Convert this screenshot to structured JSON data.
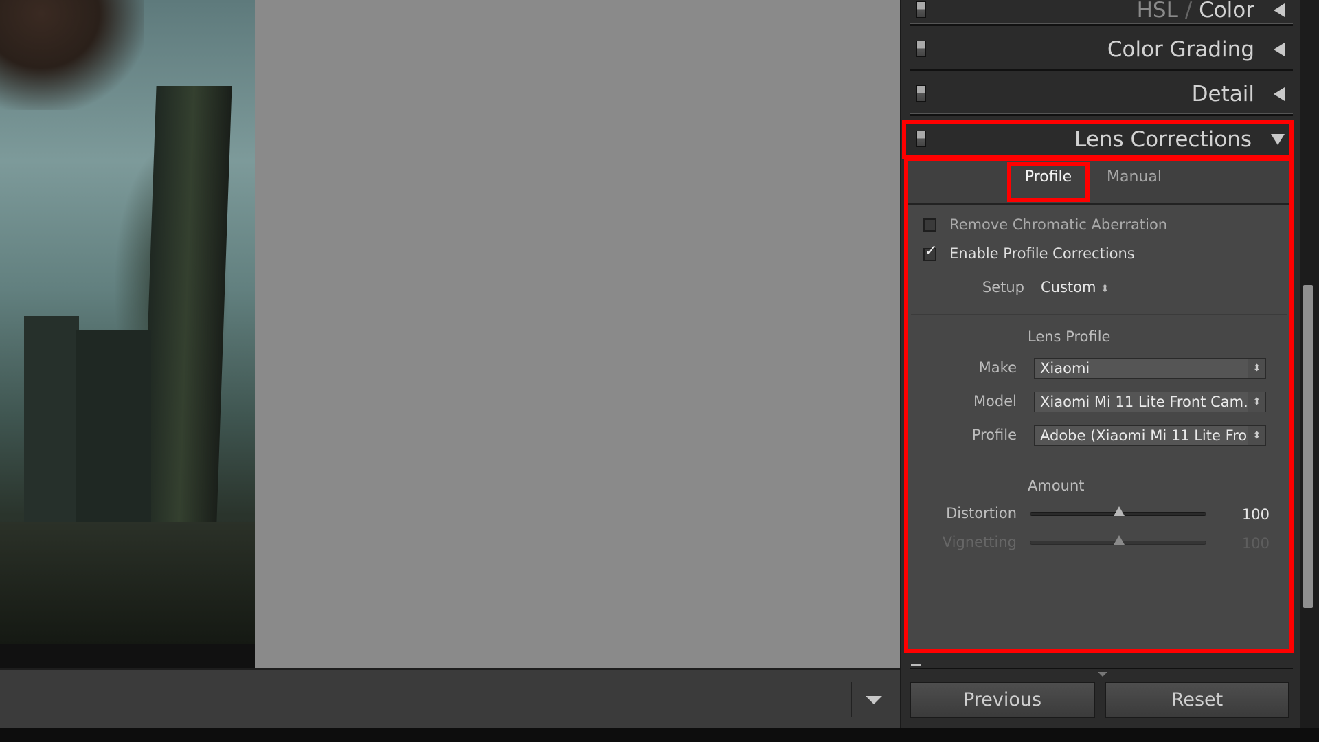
{
  "panels": {
    "hsl": {
      "label_a": "HSL",
      "divider": "/",
      "label_b": "Color"
    },
    "color_grading": {
      "label": "Color Grading"
    },
    "detail": {
      "label": "Detail"
    },
    "lens_corrections": {
      "label": "Lens Corrections",
      "expanded": true
    }
  },
  "lens": {
    "tabs": [
      {
        "label": "Profile",
        "active": true
      },
      {
        "label": "Manual",
        "active": false
      }
    ],
    "remove_ca": {
      "label": "Remove Chromatic Aberration",
      "checked": false
    },
    "enable_profile": {
      "label": "Enable Profile Corrections",
      "checked": true,
      "check_glyph": "✓"
    },
    "setup": {
      "label": "Setup",
      "value": "Custom"
    },
    "lens_profile": {
      "title": "Lens Profile",
      "make": {
        "label": "Make",
        "value": "Xiaomi"
      },
      "model": {
        "label": "Model",
        "value": "Xiaomi Mi 11 Lite Front Cam..."
      },
      "profile": {
        "label": "Profile",
        "value": "Adobe (Xiaomi Mi 11 Lite Fro..."
      }
    },
    "amount": {
      "title": "Amount",
      "distortion": {
        "label": "Distortion",
        "value": "100",
        "min": 0,
        "max": 200
      },
      "vignetting": {
        "label": "Vignetting",
        "value": "100",
        "min": 0,
        "max": 200,
        "disabled": true
      }
    }
  },
  "buttons": {
    "previous": "Previous",
    "reset": "Reset"
  },
  "highlight_color": "#ff0000"
}
